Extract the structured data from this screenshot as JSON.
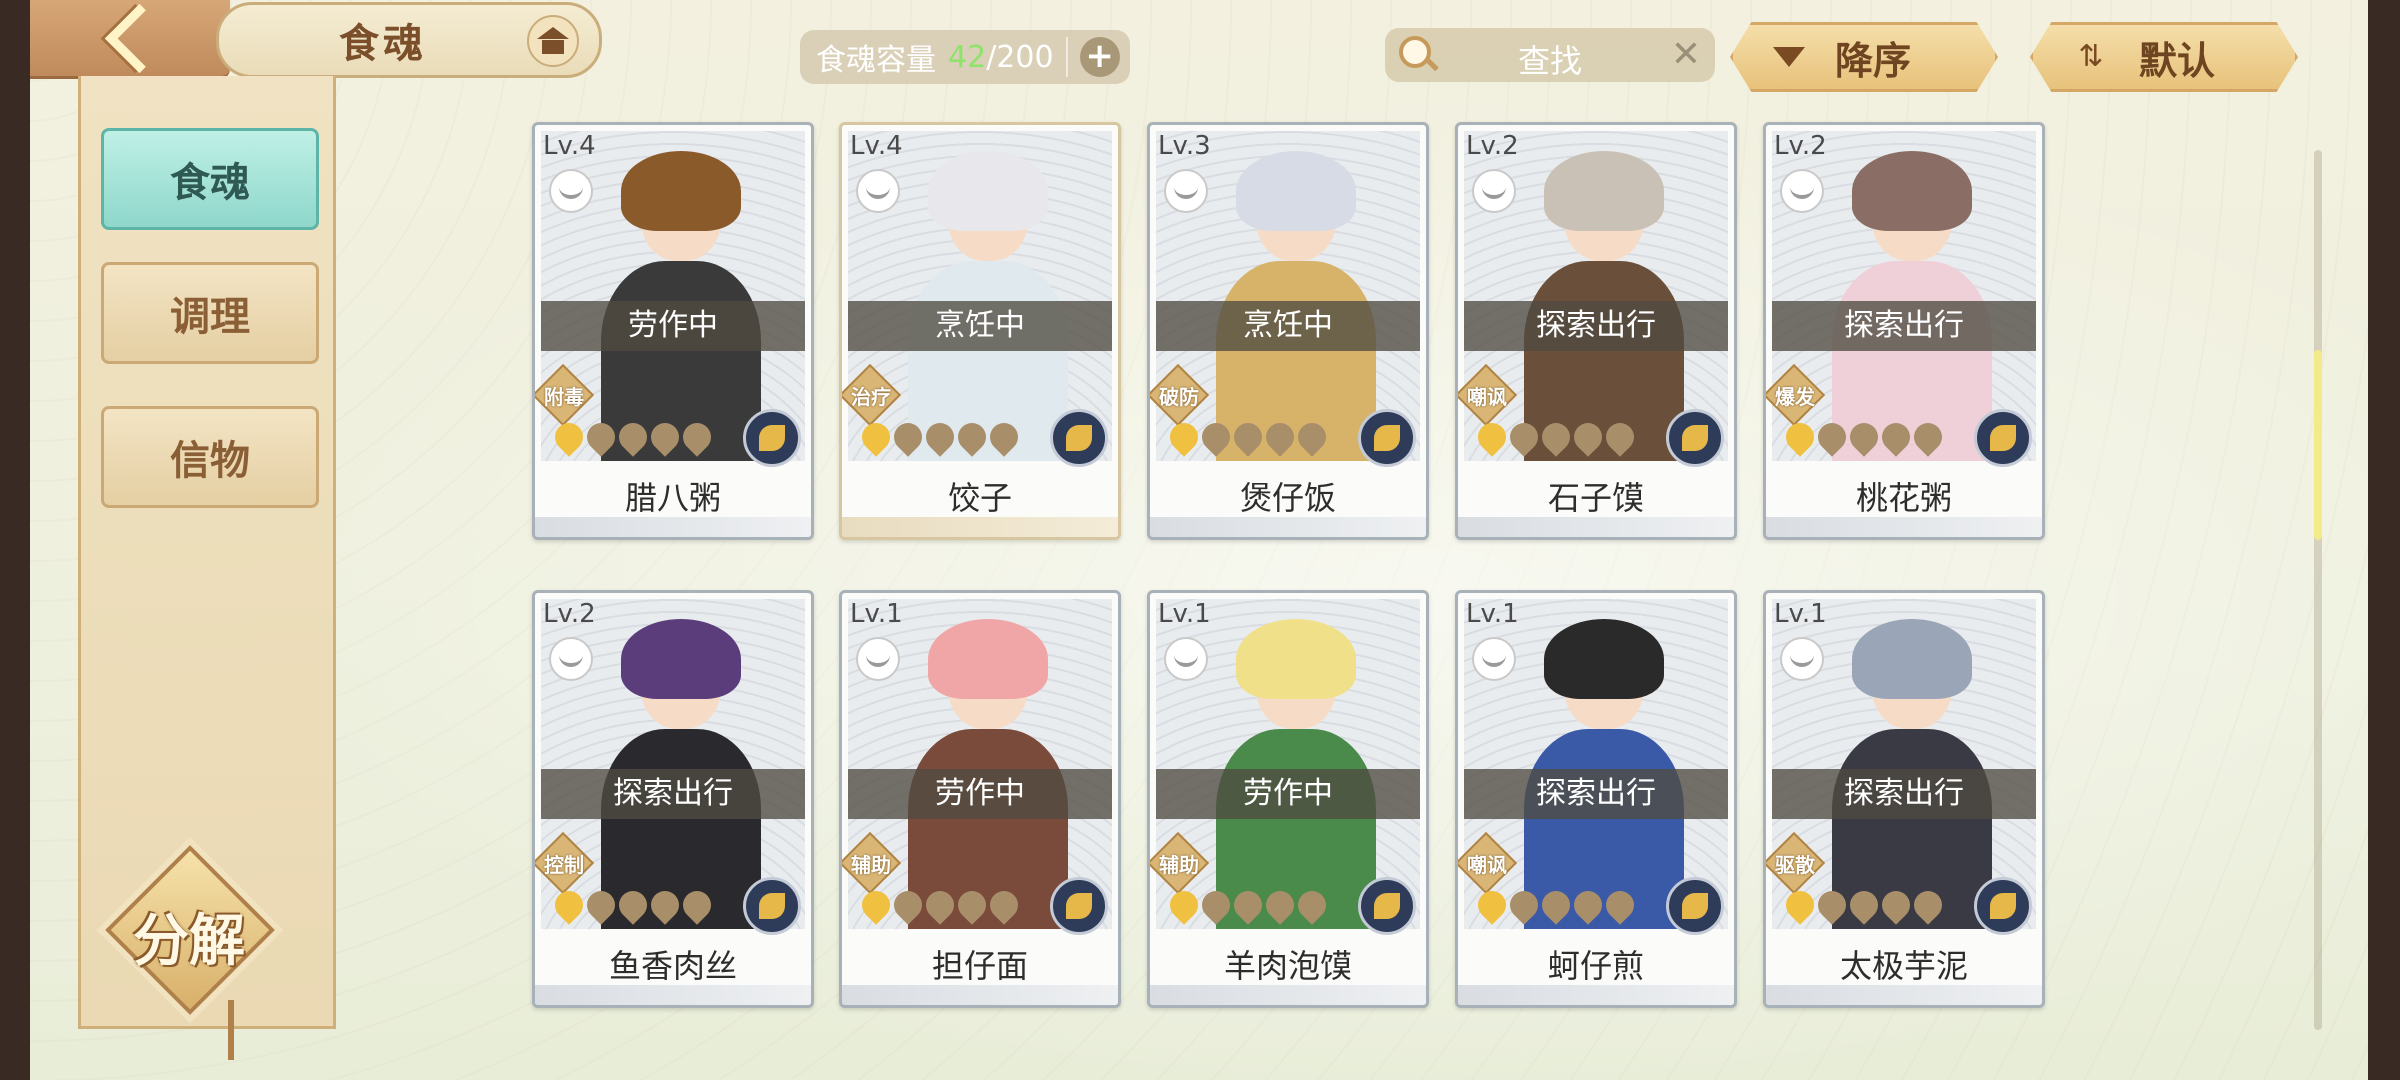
{
  "header": {
    "title": "食魂",
    "capacity_label": "食魂容量",
    "capacity_current": "42",
    "capacity_sep": "/",
    "capacity_max": "200",
    "capacity_add": "+",
    "search_placeholder": "查找",
    "clear_symbol": "✕",
    "sort_desc_label": "降序",
    "sort_default_label": "默认"
  },
  "sidebar": {
    "items": [
      {
        "label": "食魂",
        "active": true
      },
      {
        "label": "调理",
        "active": false
      },
      {
        "label": "信物",
        "active": false
      }
    ],
    "decompose_label": "分解"
  },
  "colors": {
    "capacity_current": "#8ee36a",
    "active_tab": "#8fd7cb",
    "star_on": "#f0c040"
  },
  "cards": [
    {
      "level": "Lv.4",
      "status": "劳作中",
      "tag": "附毒",
      "stars_on": 1,
      "stars_total": 5,
      "name": "腊八粥"
    },
    {
      "level": "Lv.4",
      "status": "烹饪中",
      "tag": "治疗",
      "stars_on": 1,
      "stars_total": 5,
      "name": "饺子"
    },
    {
      "level": "Lv.3",
      "status": "烹饪中",
      "tag": "破防",
      "stars_on": 1,
      "stars_total": 5,
      "name": "煲仔饭"
    },
    {
      "level": "Lv.2",
      "status": "探索出行",
      "tag": "嘲讽",
      "stars_on": 1,
      "stars_total": 5,
      "name": "石子馍"
    },
    {
      "level": "Lv.2",
      "status": "探索出行",
      "tag": "爆发",
      "stars_on": 1,
      "stars_total": 5,
      "name": "桃花粥"
    },
    {
      "level": "Lv.2",
      "status": "探索出行",
      "tag": "控制",
      "stars_on": 1,
      "stars_total": 5,
      "name": "鱼香肉丝"
    },
    {
      "level": "Lv.1",
      "status": "劳作中",
      "tag": "辅助",
      "stars_on": 1,
      "stars_total": 5,
      "name": "担仔面"
    },
    {
      "level": "Lv.1",
      "status": "劳作中",
      "tag": "辅助",
      "stars_on": 1,
      "stars_total": 5,
      "name": "羊肉泡馍"
    },
    {
      "level": "Lv.1",
      "status": "探索出行",
      "tag": "嘲讽",
      "stars_on": 1,
      "stars_total": 5,
      "name": "蚵仔煎"
    },
    {
      "level": "Lv.1",
      "status": "探索出行",
      "tag": "驱散",
      "stars_on": 1,
      "stars_total": 5,
      "name": "太极芋泥"
    }
  ]
}
